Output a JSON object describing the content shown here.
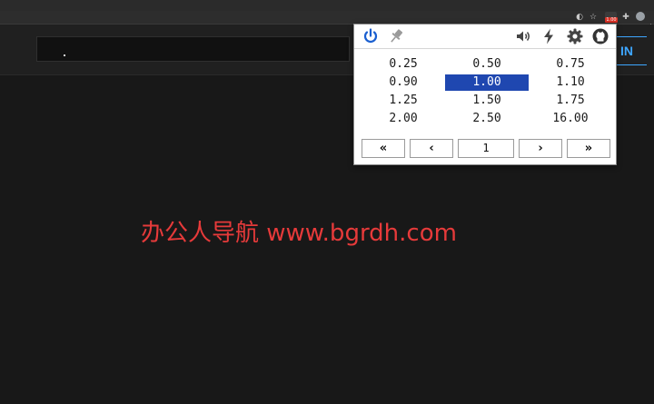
{
  "browser": {
    "toolbar_icons": [
      "screen-share-icon",
      "star-icon",
      "puzzle-icon",
      "user-icon",
      "menu-icon"
    ],
    "extension_badge": "1.00"
  },
  "page": {
    "signin_label": "IN",
    "search_value": "."
  },
  "popup": {
    "header_icons_left": [
      "power-icon",
      "pin-icon"
    ],
    "header_icons_right": [
      "volume-icon",
      "bolt-icon",
      "gear-icon",
      "github-icon"
    ],
    "speeds": [
      [
        "0.25",
        "0.50",
        "0.75"
      ],
      [
        "0.90",
        "1.00",
        "1.10"
      ],
      [
        "1.25",
        "1.50",
        "1.75"
      ],
      [
        "2.00",
        "2.50",
        "16.00"
      ]
    ],
    "selected_speed": "1.00",
    "pager": {
      "first_label": "«",
      "prev_label": "‹",
      "page_value": "1",
      "next_label": "›",
      "last_label": "»"
    }
  },
  "watermark": {
    "text": "办公人导航 www.bgrdh.com"
  },
  "colors": {
    "accent": "#1f47b0",
    "power": "#1a5fd0",
    "signin": "#3ea6ff",
    "watermark": "#e63a3a"
  }
}
